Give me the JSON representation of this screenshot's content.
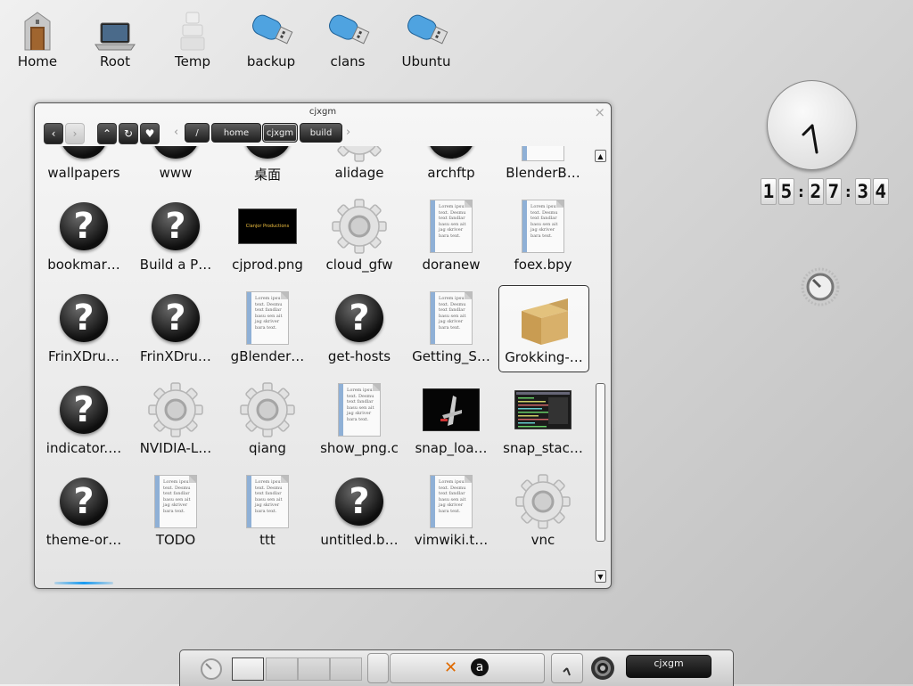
{
  "desktop": {
    "icons": [
      {
        "label": "Home"
      },
      {
        "label": "Root"
      },
      {
        "label": "Temp"
      },
      {
        "label": "backup"
      },
      {
        "label": "clans"
      },
      {
        "label": "Ubuntu"
      }
    ]
  },
  "window": {
    "title": "cjxgm",
    "close": "×",
    "toolbar": {
      "back": "‹",
      "forward": "›",
      "up": "⌃",
      "refresh": "↻",
      "favorite": "♥",
      "crumb_prev": "‹",
      "crumb_next": "›",
      "breadcrumbs": [
        "/",
        "home",
        "cjxgm",
        "build"
      ]
    },
    "items": [
      {
        "name": "wallpapers",
        "icon": "question-icon"
      },
      {
        "name": "www",
        "icon": "question-icon"
      },
      {
        "name": "桌面",
        "icon": "question-icon"
      },
      {
        "name": "alidage",
        "icon": "gear-icon"
      },
      {
        "name": "archftp",
        "icon": "question-icon"
      },
      {
        "name": "BlenderB…",
        "icon": "document-icon"
      },
      {
        "name": "bookmar…",
        "icon": "question-icon"
      },
      {
        "name": "Build a P…",
        "icon": "question-icon"
      },
      {
        "name": "cjprod.png",
        "icon": "image-thumbnail",
        "thumb_text": "Clanjor Productions"
      },
      {
        "name": "cloud_gfw",
        "icon": "gear-icon"
      },
      {
        "name": "doranew",
        "icon": "document-icon"
      },
      {
        "name": "foex.bpy",
        "icon": "document-icon"
      },
      {
        "name": "FrinXDru…",
        "icon": "question-icon"
      },
      {
        "name": "FrinXDru…",
        "icon": "question-icon"
      },
      {
        "name": "gBlender…",
        "icon": "document-icon"
      },
      {
        "name": "get-hosts",
        "icon": "question-icon"
      },
      {
        "name": "Getting_S…",
        "icon": "document-icon"
      },
      {
        "name": "Grokking-…",
        "icon": "package-icon",
        "selected": true
      },
      {
        "name": "indicator.…",
        "icon": "question-icon"
      },
      {
        "name": "NVIDIA-L…",
        "icon": "gear-icon"
      },
      {
        "name": "qiang",
        "icon": "gear-icon"
      },
      {
        "name": "show_png.c",
        "icon": "document-icon"
      },
      {
        "name": "snap_loa…",
        "icon": "snap-thumbnail"
      },
      {
        "name": "snap_stac…",
        "icon": "terminal-thumbnail"
      },
      {
        "name": "theme-or…",
        "icon": "question-icon"
      },
      {
        "name": "TODO",
        "icon": "document-icon"
      },
      {
        "name": "ttt",
        "icon": "document-icon"
      },
      {
        "name": "untitled.b…",
        "icon": "question-icon"
      },
      {
        "name": "vimwiki.t…",
        "icon": "document-icon"
      },
      {
        "name": "vnc",
        "icon": "gear-icon"
      }
    ],
    "doc_preview_text": "Lorem ipsum text. Desmu text fandlar basu sen ait jag skriver bara text.",
    "question_glyph": "?",
    "scroll": {
      "up": "▲",
      "down": "▼"
    }
  },
  "clock": {
    "digits": [
      "1",
      "5",
      "2",
      "7",
      "3",
      "4"
    ],
    "time": "15:27:34",
    "separator": ":"
  },
  "taskbar": {
    "pagers": 4,
    "active_pager": 0,
    "task_label": "cjxgm",
    "tray_icons": [
      "crack-icon",
      "amarok-icon"
    ]
  },
  "colors": {
    "accent": "#1a9bf0",
    "button_dark": "#1e1e1e"
  }
}
